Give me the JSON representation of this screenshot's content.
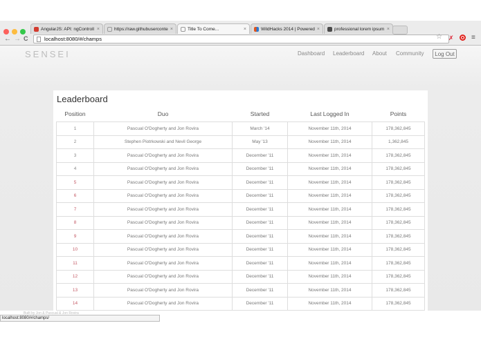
{
  "browser": {
    "tabs": [
      {
        "title": "AngularJS: API: ngControll",
        "icon_color": "#d23b2f",
        "active": false
      },
      {
        "title": "https://raw.githubuserconte",
        "icon_color": "#ffffff",
        "active": false
      },
      {
        "title": "Title To Come...",
        "icon_color": "#ffffff",
        "active": true
      },
      {
        "title": "WildHacks 2014 | Powered",
        "icon_color": "#e2531a",
        "active": false
      },
      {
        "title": "professional lorem ipsum",
        "icon_color": "#4a4a4a",
        "active": false
      }
    ],
    "tab_close": "×",
    "url": "localhost:8080/#/champs",
    "status_url": "localhost:8080/#/champs/",
    "nav": {
      "back": "←",
      "forward": "→",
      "reload": "C"
    },
    "star": "☆",
    "ext_icon": "✗",
    "menu": "≡"
  },
  "app": {
    "brand": "SENSEI",
    "nav": [
      "Dashboard",
      "Leaderboard",
      "About",
      "Community"
    ],
    "logout": "Log Out"
  },
  "leaderboard": {
    "title": "Leaderboard",
    "columns": [
      "Position",
      "Duo",
      "Started",
      "Last Logged In",
      "Points"
    ],
    "rows": [
      {
        "position": "1",
        "duo": "Pascual O'Dogherty and Jon Rovira",
        "started": "March '14",
        "last": "November 11th, 2014",
        "points": "178,362,845"
      },
      {
        "position": "2",
        "duo": "Stephen Piotrkowski and Nevil George",
        "started": "May '13",
        "last": "November 11th, 2014",
        "points": "1,362,845"
      },
      {
        "position": "3",
        "duo": "Pascual O'Dogherty and Jon Rovira",
        "started": "December '11",
        "last": "November 11th, 2014",
        "points": "178,362,845"
      },
      {
        "position": "4",
        "duo": "Pascual O'Dogherty and Jon Rovira",
        "started": "December '11",
        "last": "November 11th, 2014",
        "points": "178,362,845"
      },
      {
        "position": "5",
        "duo": "Pascual O'Dogherty and Jon Rovira",
        "started": "December '11",
        "last": "November 11th, 2014",
        "points": "178,362,845"
      },
      {
        "position": "6",
        "duo": "Pascual O'Dogherty and Jon Rovira",
        "started": "December '11",
        "last": "November 11th, 2014",
        "points": "178,362,845"
      },
      {
        "position": "7",
        "duo": "Pascual O'Dogherty and Jon Rovira",
        "started": "December '11",
        "last": "November 11th, 2014",
        "points": "178,362,845"
      },
      {
        "position": "8",
        "duo": "Pascual O'Dogherty and Jon Rovira",
        "started": "December '11",
        "last": "November 11th, 2014",
        "points": "178,362,845"
      },
      {
        "position": "9",
        "duo": "Pascual O'Dogherty and Jon Rovira",
        "started": "December '11",
        "last": "November 11th, 2014",
        "points": "178,362,845"
      },
      {
        "position": "10",
        "duo": "Pascual O'Dogherty and Jon Rovira",
        "started": "December '11",
        "last": "November 11th, 2014",
        "points": "178,362,845"
      },
      {
        "position": "11",
        "duo": "Pascual O'Dogherty and Jon Rovira",
        "started": "December '11",
        "last": "November 11th, 2014",
        "points": "178,362,845"
      },
      {
        "position": "12",
        "duo": "Pascual O'Dogherty and Jon Rovira",
        "started": "December '11",
        "last": "November 11th, 2014",
        "points": "178,362,845"
      },
      {
        "position": "13",
        "duo": "Pascual O'Dogherty and Jon Rovira",
        "started": "December '11",
        "last": "November 11th, 2014",
        "points": "178,362,845"
      },
      {
        "position": "14",
        "duo": "Pascual O'Dogherty and Jon Rovira",
        "started": "December '11",
        "last": "November 11th, 2014",
        "points": "178,362,845"
      }
    ]
  },
  "footer_faint": "Built by Jon & Pascual & Jon Rovira",
  "colors": {
    "position_accent": "#c45a66",
    "window_red": "#fc605c",
    "window_yellow": "#fdbc40",
    "window_green": "#34c84a"
  }
}
